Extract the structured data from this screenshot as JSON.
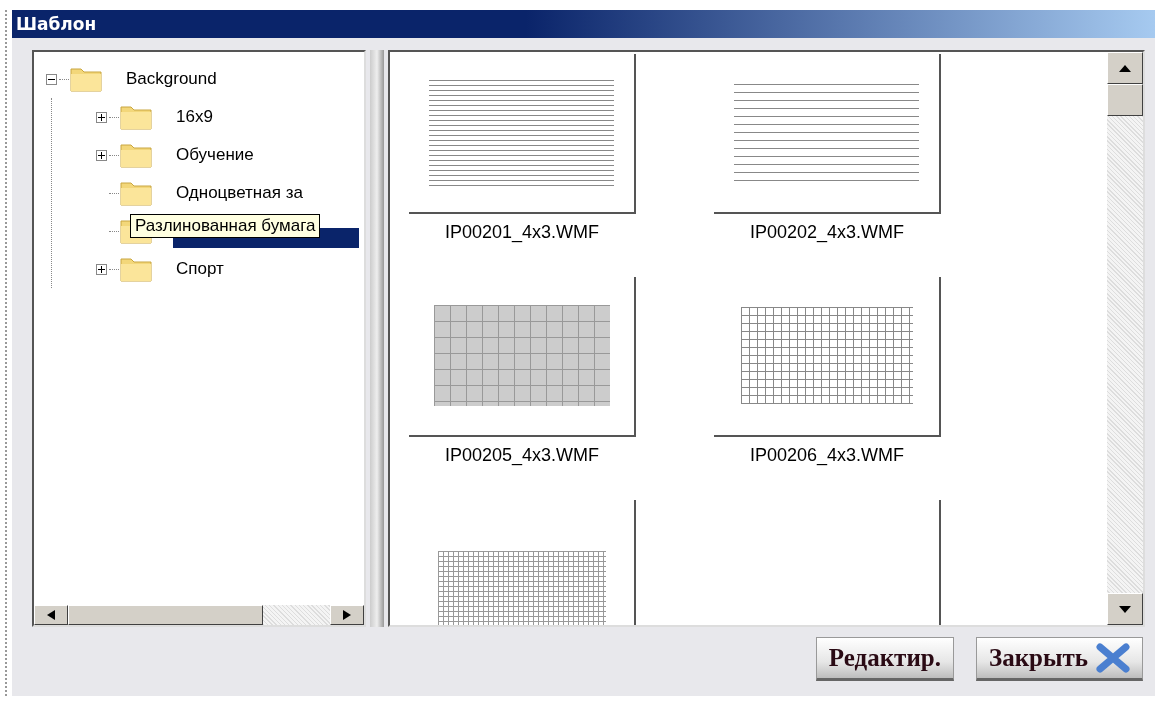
{
  "window": {
    "title": "Шаблон"
  },
  "tree": [
    {
      "label": "Background",
      "expanded": true,
      "selected": false,
      "children": [
        {
          "label": "16x9",
          "expanded": false,
          "selected": false
        },
        {
          "label": "Обучение",
          "expanded": false,
          "selected": false
        },
        {
          "label": "Одноцветная за",
          "selected": false
        },
        {
          "selected": true,
          "tooltip": "Разлинованная бумага"
        },
        {
          "label": "Спорт",
          "expanded": false,
          "selected": false
        }
      ]
    }
  ],
  "thumbnails": [
    {
      "kind": "lined-dense",
      "caption": "IP00201_4x3.WMF"
    },
    {
      "kind": "lined",
      "caption": "IP00202_4x3.WMF"
    },
    {
      "kind": "grid-shaded",
      "caption": "IP00205_4x3.WMF"
    },
    {
      "kind": "grid",
      "caption": "IP00206_4x3.WMF"
    },
    {
      "kind": "grid-fine"
    },
    {
      "kind": "blank"
    }
  ],
  "buttons": [
    {
      "label": "Редактир.",
      "kind": "edit"
    },
    {
      "label": "Закрыть",
      "kind": "close"
    }
  ]
}
